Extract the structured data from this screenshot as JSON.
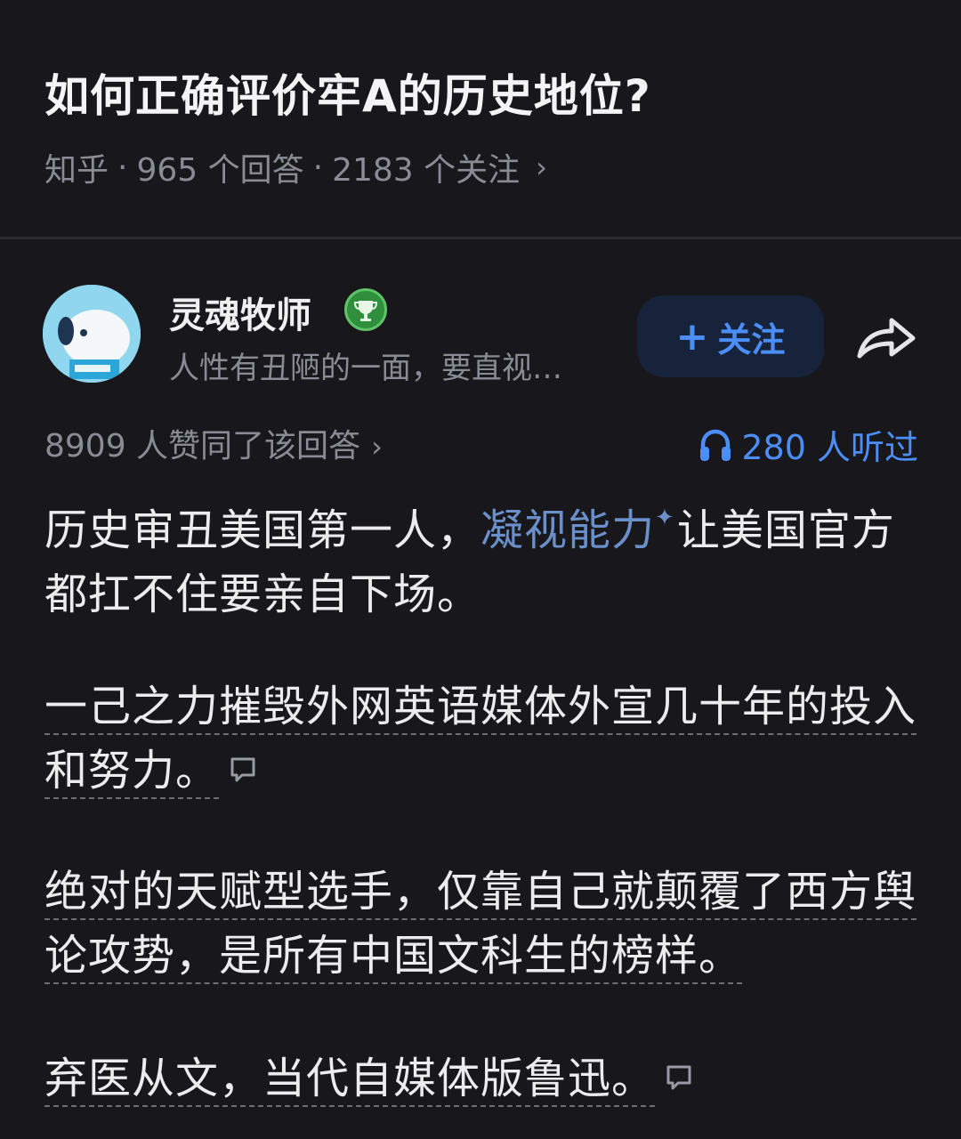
{
  "question": {
    "title": "如何正确评价牢A的历史地位?",
    "platform": "知乎",
    "answers": "965 个回答",
    "followers": "2183 个关注",
    "separator": "·",
    "chevron": "›"
  },
  "author": {
    "name": "灵魂牧师",
    "bio": "人性有丑陋的一面，要直视…",
    "badge_icon": "trophy-badge-icon",
    "follow_label": "关注",
    "follow_plus": "+",
    "accent_color": "#4b8ef7"
  },
  "stats": {
    "agree": "8909 人赞同了该回答",
    "listened": "280 人听过",
    "chevron": "›"
  },
  "answer": {
    "p1_a": "历史审丑美国第一人，",
    "p1_link": "凝视能力",
    "p1_spark": "✦",
    "p1_b": "让美国官方都扛不住要亲自下场。",
    "p2": "一己之力摧毁外网英语媒体外宣几十年的投入和努力。",
    "p3": "绝对的天赋型选手，仅靠自己就颠覆了西方舆论攻势，是所有中国文科生的榜样。",
    "p4": "弃医从文，当代自媒体版鲁迅。"
  },
  "icons": [
    "share-icon",
    "headphone-icon",
    "comment-icon",
    "avatar-image",
    "trophy-badge-icon"
  ]
}
